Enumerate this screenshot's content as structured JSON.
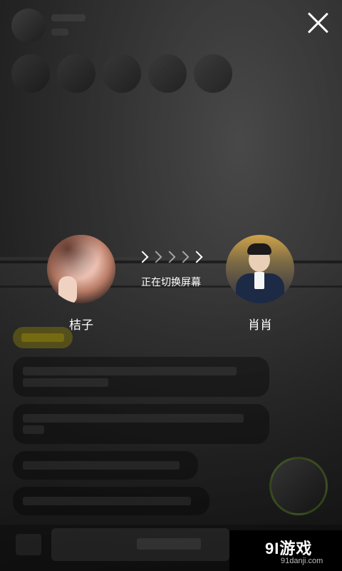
{
  "switch": {
    "left_name": "桔子",
    "right_name": "肖肖",
    "status_text": "正在切换屏幕"
  },
  "watermark": {
    "logo": "9Ɩ游戏",
    "url": "91danji.com"
  },
  "icons": {
    "close": "close-icon",
    "arrows": "chevron-right-icon"
  },
  "colors": {
    "overlay": "#000000",
    "text": "#ffffff",
    "chip": "#ffe600",
    "guest_ring": "#8cdc28"
  }
}
